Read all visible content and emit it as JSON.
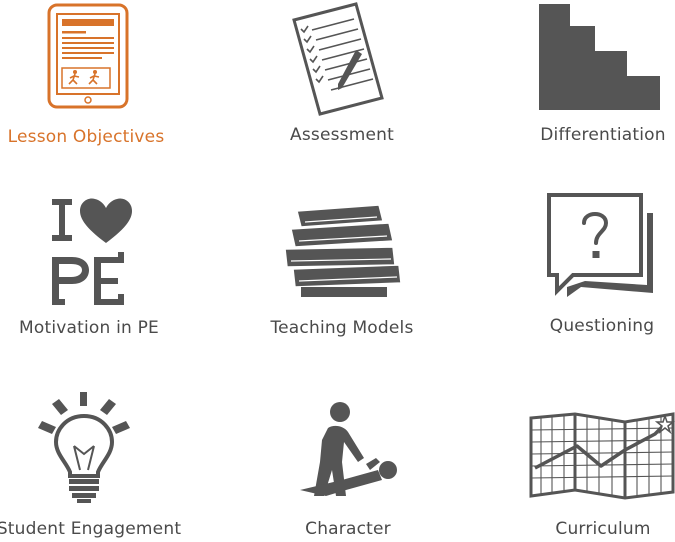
{
  "colors": {
    "active": "#d8732a",
    "icon": "#555555",
    "text": "#4a4a4a"
  },
  "menu": {
    "items": [
      {
        "label": "Lesson Objectives",
        "icon": "tablet-icon",
        "active": true
      },
      {
        "label": "Assessment",
        "icon": "checklist-pencil-icon",
        "active": false
      },
      {
        "label": "Differentiation",
        "icon": "staircase-icon",
        "active": false
      },
      {
        "label": "Motivation in PE",
        "icon": "i-heart-pe-icon",
        "active": false
      },
      {
        "label": "Teaching Models",
        "icon": "book-stack-icon",
        "active": false
      },
      {
        "label": "Questioning",
        "icon": "question-bubble-icon",
        "active": false
      },
      {
        "label": "Student Engagement",
        "icon": "lightbulb-icon",
        "active": false
      },
      {
        "label": "Character",
        "icon": "helping-person-icon",
        "active": false
      },
      {
        "label": "Curriculum",
        "icon": "graph-map-icon",
        "active": false
      }
    ]
  },
  "logo_text": {
    "i_heart_pe": "I PE"
  }
}
